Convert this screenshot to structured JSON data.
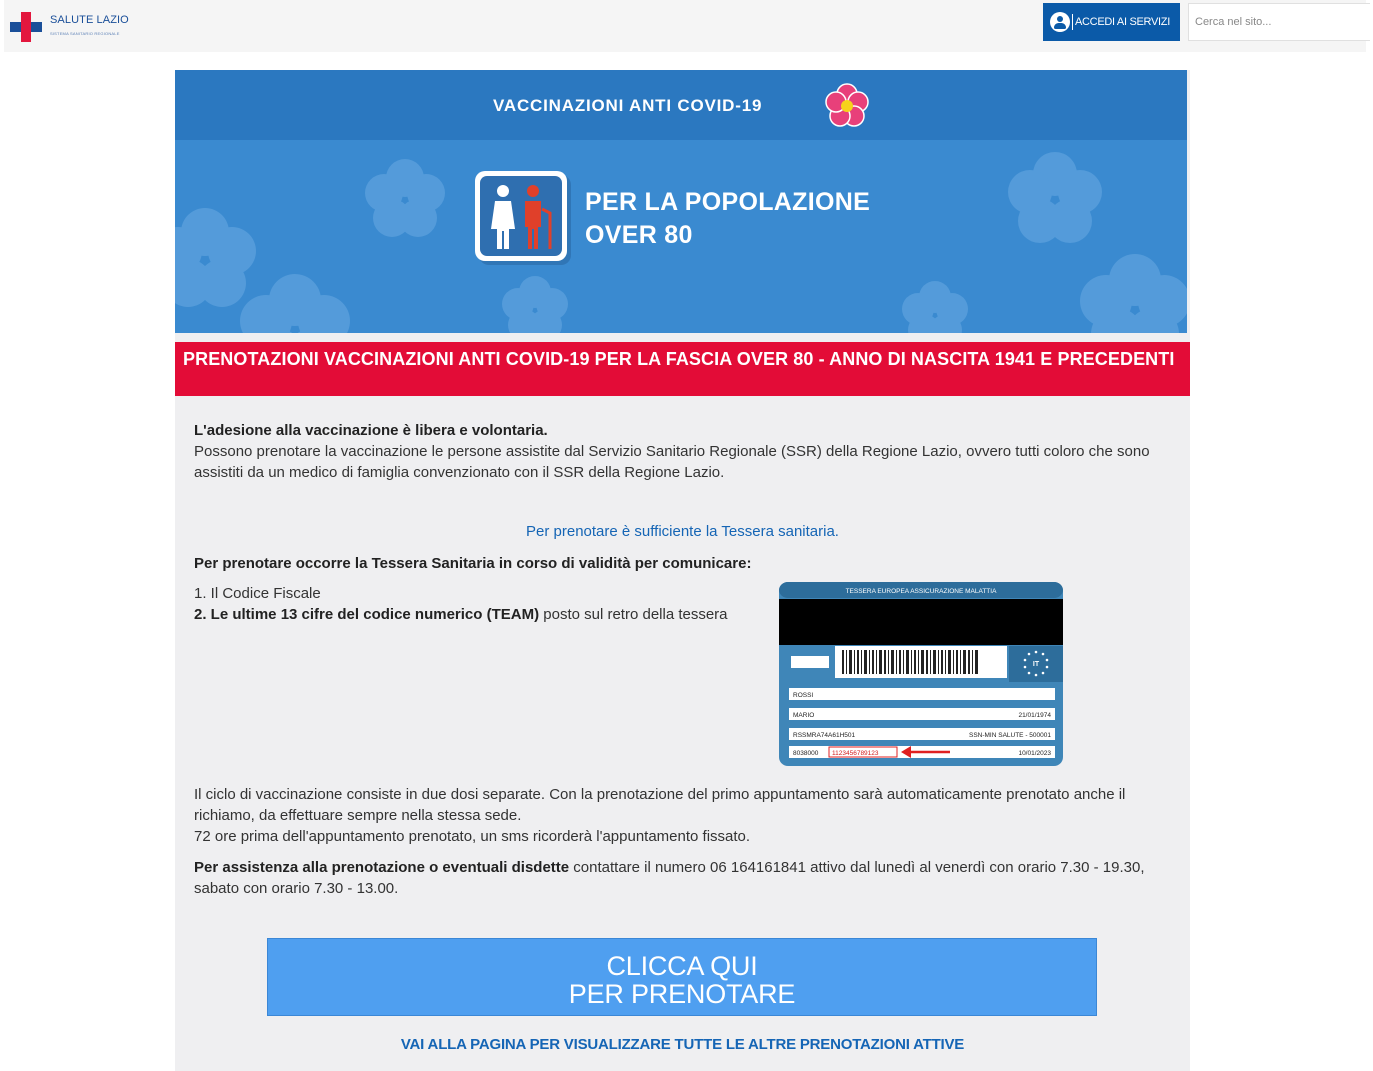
{
  "header": {
    "logo_title": "SALUTE LAZIO",
    "logo_subtitle": "SISTEMA SANITARIO REGIONALE",
    "access_label": "ACCEDI AI SERVIZI",
    "search_placeholder": "Cerca nel sito..."
  },
  "banner": {
    "title": "VACCINAZIONI ANTI COVID-19",
    "headline_line1": "PER LA POPOLAZIONE",
    "headline_line2": "OVER 80"
  },
  "section": {
    "title": "PRENOTAZIONI VACCINAZIONI ANTI COVID-19 PER LA FASCIA OVER 80 - ANNO DI NASCITA 1941 E PRECEDENTI",
    "intro_bold": "L'adesione alla vaccinazione è libera e volontaria.",
    "intro_text": "Possono prenotare la vaccinazione le persone assistite dal Servizio Sanitario Regionale (SSR) della Regione Lazio, ovvero tutti coloro che sono assistiti da un medico di famiglia convenzionato con il SSR della Regione Lazio.",
    "note": "Per prenotare è sufficiente la Tessera sanitaria.",
    "requirement_bold": "Per prenotare occorre la Tessera Sanitaria in corso di validità per comunicare:",
    "step1": "1. Il Codice Fiscale",
    "step2_bold": "2. Le ultime 13 cifre del codice numerico (TEAM)",
    "step2_rest": " posto sul retro della tessera",
    "cycle_text": "Il ciclo di vaccinazione consiste in due dosi separate. Con la prenotazione del primo appuntamento sarà automaticamente prenotato anche il richiamo, da effettuare sempre nella stessa sede.",
    "sms_text": "72 ore prima dell'appuntamento prenotato, un sms ricorderà l'appuntamento fissato.",
    "assist_bold": "Per assistenza alla prenotazione o eventuali disdette",
    "assist_text": " contattare il numero 06 164161841 attivo dal lunedì al venerdì con orario 7.30 - 19.30, sabato con orario 7.30 - 13.00."
  },
  "card": {
    "header": "TESSERA EUROPEA ASSICURAZIONE MALATTIA",
    "country": "IT",
    "surname": "ROSSI",
    "name": "MARIO",
    "birth_date": "21/01/1974",
    "fiscal_code": "RSSMRA74A61H501",
    "institution": "SSN-MIN SALUTE - 500001",
    "id_prefix": "8038000",
    "id_highlight": "1123456789123",
    "expiry": "10/01/2023"
  },
  "actions": {
    "cta_line1": "CLICCA QUI",
    "cta_line2": "PER PRENOTARE",
    "all_bookings": "VAI ALLA PAGINA PER VISUALIZZARE TUTTE LE ALTRE PRENOTAZIONI ATTIVE"
  },
  "colors": {
    "brand_blue": "#0b5aa8",
    "banner_blue": "#2b78c0",
    "alert_red": "#e30c37",
    "link_blue": "#1565b5",
    "cta_blue": "#4f9ff0"
  }
}
